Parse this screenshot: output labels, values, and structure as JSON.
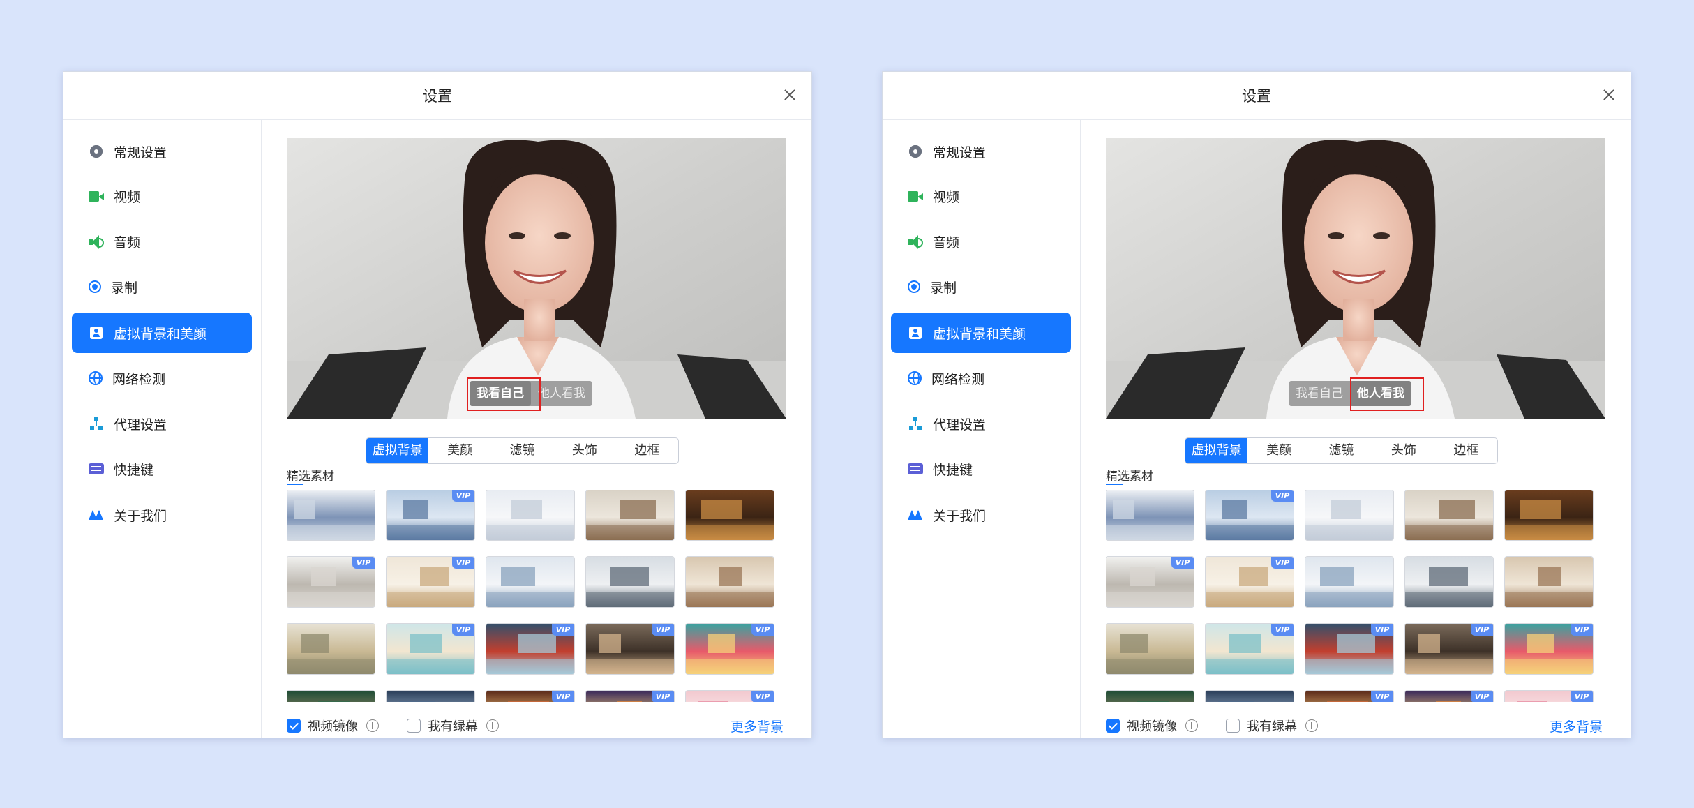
{
  "windows": [
    {
      "title": "设置",
      "sidebar": [
        {
          "label": "常规设置",
          "icon": "gear-icon"
        },
        {
          "label": "视频",
          "icon": "video-camera-icon"
        },
        {
          "label": "音频",
          "icon": "speaker-icon"
        },
        {
          "label": "录制",
          "icon": "record-icon"
        },
        {
          "label": "虚拟背景和美颜",
          "icon": "portrait-icon",
          "active": true
        },
        {
          "label": "网络检测",
          "icon": "globe-icon"
        },
        {
          "label": "代理设置",
          "icon": "network-tree-icon"
        },
        {
          "label": "快捷键",
          "icon": "keyboard-icon"
        },
        {
          "label": "关于我们",
          "icon": "logo-icon"
        }
      ],
      "preview": {
        "self_view": "我看自己",
        "others_view": "他人看我",
        "selected": "self"
      },
      "tabs": [
        "虚拟背景",
        "美颜",
        "滤镜",
        "头饰",
        "边框"
      ],
      "active_tab": "虚拟背景",
      "section_label": "精选素材",
      "vip_badge": "VIP",
      "footer": {
        "mirror_label": "视频镜像",
        "mirror_checked": true,
        "greenscreen_label": "我有绿幕",
        "greenscreen_checked": false,
        "more_link": "更多背景"
      }
    },
    {
      "title": "设置",
      "sidebar": [
        {
          "label": "常规设置",
          "icon": "gear-icon"
        },
        {
          "label": "视频",
          "icon": "video-camera-icon"
        },
        {
          "label": "音频",
          "icon": "speaker-icon"
        },
        {
          "label": "录制",
          "icon": "record-icon"
        },
        {
          "label": "虚拟背景和美颜",
          "icon": "portrait-icon",
          "active": true
        },
        {
          "label": "网络检测",
          "icon": "globe-icon"
        },
        {
          "label": "代理设置",
          "icon": "network-tree-icon"
        },
        {
          "label": "快捷键",
          "icon": "keyboard-icon"
        },
        {
          "label": "关于我们",
          "icon": "logo-icon"
        }
      ],
      "preview": {
        "self_view": "我看自己",
        "others_view": "他人看我",
        "selected": "others"
      },
      "tabs": [
        "虚拟背景",
        "美颜",
        "滤镜",
        "头饰",
        "边框"
      ],
      "active_tab": "虚拟背景",
      "section_label": "精选素材",
      "vip_badge": "VIP",
      "footer": {
        "mirror_label": "视频镜像",
        "mirror_checked": true,
        "greenscreen_label": "我有绿幕",
        "greenscreen_checked": false,
        "more_link": "更多背景"
      }
    }
  ],
  "theme": {
    "accent": "#1677ff",
    "highlight": "#e02020"
  },
  "thumbnails": [
    {
      "vip": false,
      "scene": "office-meeting-room"
    },
    {
      "vip": true,
      "scene": "office-city-view"
    },
    {
      "vip": false,
      "scene": "bright-office"
    },
    {
      "vip": false,
      "scene": "bookshelf-room"
    },
    {
      "vip": false,
      "scene": "wooden-bookshelf"
    },
    {
      "vip": true,
      "scene": "white-room-chair"
    },
    {
      "vip": true,
      "scene": "cozy-study"
    },
    {
      "vip": false,
      "scene": "window-city"
    },
    {
      "vip": false,
      "scene": "living-room"
    },
    {
      "vip": false,
      "scene": "library-hall"
    },
    {
      "vip": false,
      "scene": "classroom"
    },
    {
      "vip": true,
      "scene": "seaside-window"
    },
    {
      "vip": true,
      "scene": "chinese-garden"
    },
    {
      "vip": true,
      "scene": "sunset-room"
    },
    {
      "vip": true,
      "scene": "new-semester-board"
    },
    {
      "vip": false,
      "scene": "chalkboard"
    },
    {
      "vip": false,
      "scene": "blue-room"
    },
    {
      "vip": true,
      "scene": "festival"
    },
    {
      "vip": true,
      "scene": "lanterns"
    },
    {
      "vip": true,
      "scene": "pink-festive"
    }
  ]
}
